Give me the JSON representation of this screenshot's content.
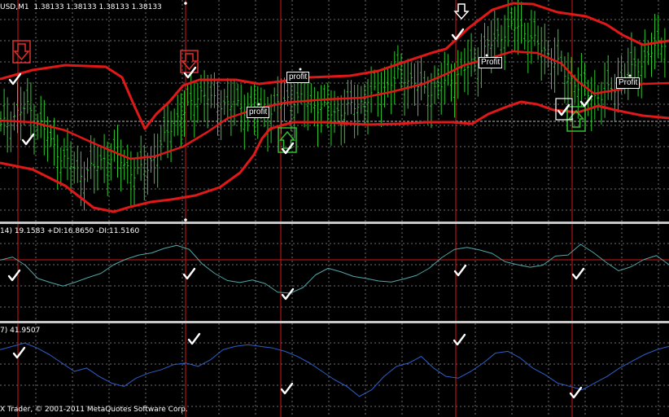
{
  "window": {
    "title": "USD,M1",
    "ohlc": "1.38133 1.38133 1.38133 1.38133"
  },
  "indicators": {
    "adx": {
      "label": "14) 19.1583 +DI:16.8650 -DI:11.5160"
    },
    "rsi": {
      "label": "7) 41.9507"
    }
  },
  "copyright": "X Trader, © 2001-2011 MetaQuotes Software Corp.",
  "annotations": {
    "profit_1": "profit",
    "profit_2": "profit",
    "profit_3": "Profit",
    "profit_4": "Profit"
  },
  "colors": {
    "background": "#000000",
    "grid": "#6e6e6e",
    "bars": "#2ecc2e",
    "bands": "#e01818",
    "signal_lines": "#d01818",
    "adx_line": "#4fa7a9",
    "rsi_line": "#2f5fc8",
    "sell_arrow": "#e03030",
    "buy_arrow": "#30c030"
  },
  "chart_data": {
    "type": "line",
    "title": "USD,M1",
    "panels": [
      "price",
      "adx",
      "rsi"
    ],
    "price_series": [
      {
        "values": [
          1.3822,
          1.3826,
          1.3829,
          1.3823,
          1.3815,
          1.381,
          1.3806,
          1.3808,
          1.3812,
          1.3811,
          1.3806,
          1.3808,
          1.3815,
          1.3824,
          1.3828,
          1.3834,
          1.3831,
          1.383,
          1.3829,
          1.3828,
          1.3827,
          1.383,
          1.3832,
          1.3831,
          1.3829,
          1.3827,
          1.3828,
          1.383,
          1.3833,
          1.3836,
          1.384,
          1.3838,
          1.3834,
          1.3836,
          1.3839,
          1.3842,
          1.3846,
          1.3851,
          1.3855,
          1.3857,
          1.3852,
          1.3848,
          1.3843,
          1.3838,
          1.3834,
          1.3832,
          1.3835,
          1.384,
          1.3843,
          1.3848,
          1.3852
        ]
      }
    ],
    "adx_series": [
      {
        "values": [
          20.5,
          21.1,
          19.5,
          16.9,
          16.1,
          15.4,
          16.2,
          17.1,
          17.9,
          19.6,
          20.7,
          21.5,
          21.9,
          22.8,
          23.4,
          22.6,
          19.8,
          17.9,
          16.5,
          16.1,
          16.6,
          15.9,
          14.2,
          14.0,
          15.1,
          17.6,
          18.9,
          18.2,
          17.3,
          16.9,
          16.4,
          16.2,
          16.8,
          17.5,
          18.9,
          21.0,
          22.6,
          23.0,
          22.5,
          21.8,
          20.2,
          19.6,
          19.1,
          19.5,
          21.3,
          21.5,
          23.6,
          22.0,
          20.1,
          18.4,
          19.2,
          20.6,
          21.4,
          19.6
        ]
      }
    ],
    "rsi_series": [
      {
        "values": [
          58,
          60,
          62,
          59,
          55,
          50,
          45,
          47,
          42,
          38,
          36,
          41,
          44,
          46,
          49,
          50,
          48,
          52,
          58,
          60,
          61,
          60,
          59,
          57,
          54,
          50,
          45,
          40,
          36,
          30,
          34,
          42,
          48,
          50,
          54,
          47,
          42,
          41,
          45,
          50,
          56,
          57,
          53,
          47,
          43,
          38,
          36,
          34,
          38,
          42,
          47,
          51,
          55,
          58,
          60
        ]
      }
    ]
  }
}
